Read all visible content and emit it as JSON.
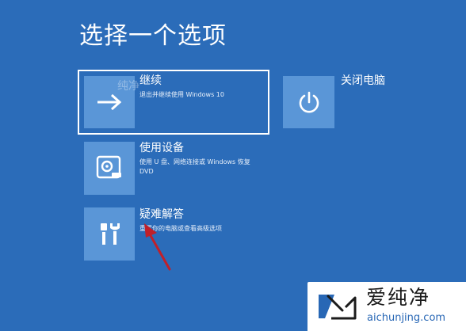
{
  "page": {
    "title": "选择一个选项"
  },
  "options": {
    "continue": {
      "label": "继续",
      "description": "退出并继续使用 Windows 10",
      "icon": "arrow-right-icon"
    },
    "use_device": {
      "label": "使用设备",
      "description": "使用 U 盘、网络连接或 Windows 恢复 DVD",
      "icon": "disc-drive-icon"
    },
    "troubleshoot": {
      "label": "疑难解答",
      "description": "重置你的电脑或查看高级选项",
      "icon": "tools-icon"
    },
    "shutdown": {
      "label": "关闭电脑",
      "icon": "power-icon"
    }
  },
  "watermark": {
    "overlay_text": "纯净",
    "brand": "爱纯净",
    "url": "aichunjing.com"
  },
  "colors": {
    "background": "#2b6cb9",
    "tile": "#5a96d7",
    "annotation_arrow": "#c0202a"
  }
}
